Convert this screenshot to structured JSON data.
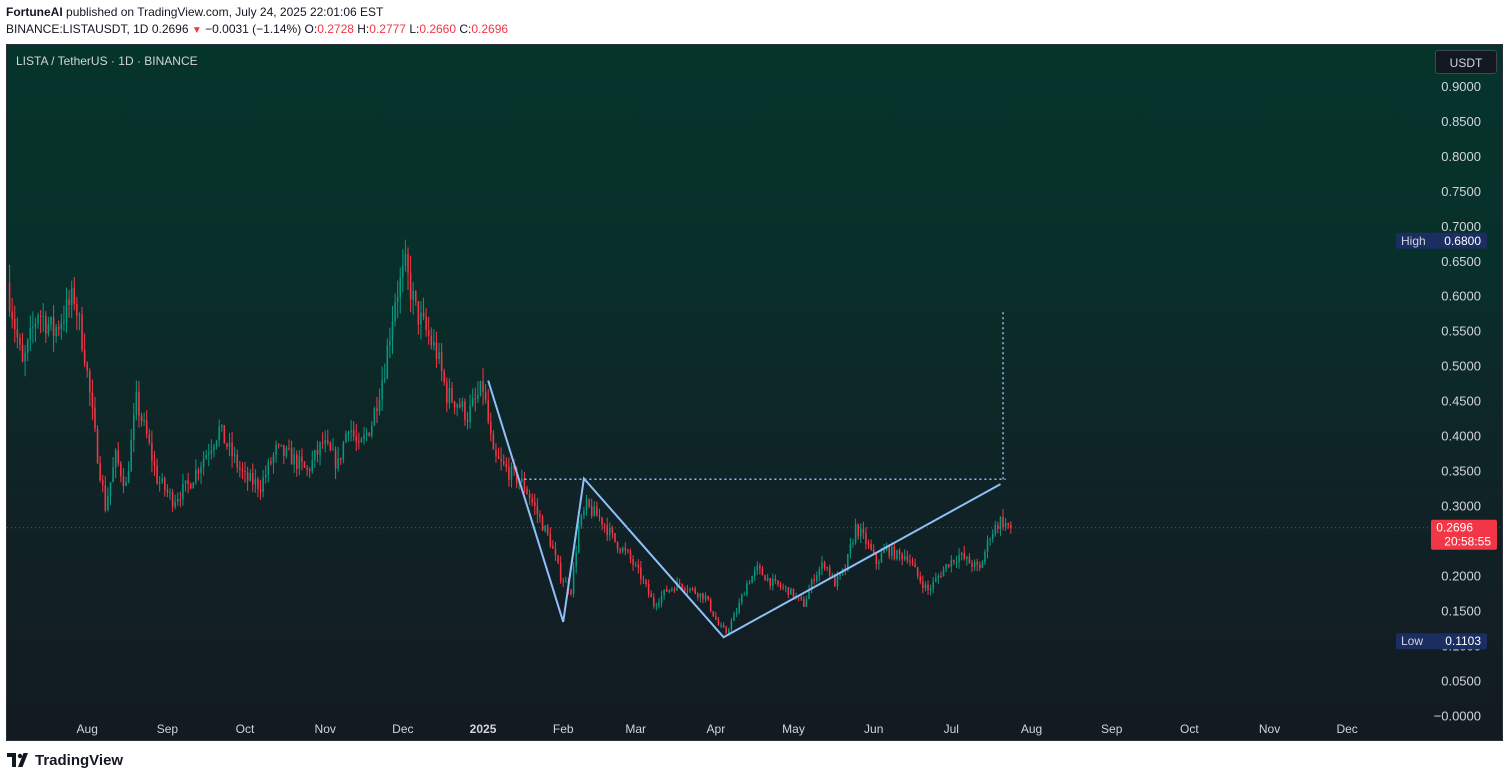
{
  "header": {
    "author": "FortuneAI",
    "published_text": "published on TradingView.com, July 24, 2025 22:01:06 EST",
    "symbol_line": "BINANCE:LISTAUSDT, 1D",
    "last": "0.2696",
    "change": "−0.0031 (−1.14%)",
    "o_label": "O:",
    "o": "0.2728",
    "h_label": "H:",
    "h": "0.2777",
    "l_label": "L:",
    "l": "0.2660",
    "c_label": "C:",
    "c": "0.2696"
  },
  "chart": {
    "symbol_title": "LISTA / TetherUS · 1D · BINANCE",
    "currency_button": "USDT",
    "high_label": "High",
    "high_value": "0.6800",
    "low_label": "Low",
    "low_value": "0.1103",
    "price_tag": "0.2696",
    "countdown": "20:58:55"
  },
  "footer": {
    "brand": "TradingView"
  },
  "colors": {
    "up": "#089981",
    "down": "#f23645",
    "drawing": "#90bff9",
    "axis_text": "#d1d4dc"
  },
  "chart_data": {
    "type": "candlestick",
    "y_ticks": [
      "0.9000",
      "0.8500",
      "0.8000",
      "0.7500",
      "0.7000",
      "0.6500",
      "0.6000",
      "0.5500",
      "0.5000",
      "0.4500",
      "0.4000",
      "0.3500",
      "0.3000",
      "0.2500",
      "0.2000",
      "0.1500",
      "0.1000",
      "0.0500",
      "−0.0000"
    ],
    "ylim": [
      -0.0125,
      0.96
    ],
    "x_labels": [
      {
        "label": "Aug",
        "day": 31,
        "bold": false
      },
      {
        "label": "Sep",
        "day": 62,
        "bold": false
      },
      {
        "label": "Oct",
        "day": 92,
        "bold": false
      },
      {
        "label": "Nov",
        "day": 123,
        "bold": false
      },
      {
        "label": "Dec",
        "day": 153,
        "bold": false
      },
      {
        "label": "2025",
        "day": 184,
        "bold": true
      },
      {
        "label": "Feb",
        "day": 215,
        "bold": false
      },
      {
        "label": "Mar",
        "day": 243,
        "bold": false
      },
      {
        "label": "Apr",
        "day": 274,
        "bold": false
      },
      {
        "label": "May",
        "day": 304,
        "bold": false
      },
      {
        "label": "Jun",
        "day": 335,
        "bold": false
      },
      {
        "label": "Jul",
        "day": 365,
        "bold": false
      },
      {
        "label": "Aug",
        "day": 396,
        "bold": false
      },
      {
        "label": "Sep",
        "day": 427,
        "bold": false
      },
      {
        "label": "Oct",
        "day": 457,
        "bold": false
      },
      {
        "label": "Nov",
        "day": 488,
        "bold": false
      },
      {
        "label": "Dec",
        "day": 518,
        "bold": false
      }
    ],
    "day_range": [
      0,
      545
    ],
    "last_day": 388,
    "price_anchors": [
      [
        0,
        0.62
      ],
      [
        6,
        0.5
      ],
      [
        12,
        0.58
      ],
      [
        18,
        0.55
      ],
      [
        26,
        0.6
      ],
      [
        30,
        0.52
      ],
      [
        34,
        0.4
      ],
      [
        38,
        0.3
      ],
      [
        42,
        0.37
      ],
      [
        46,
        0.33
      ],
      [
        50,
        0.45
      ],
      [
        54,
        0.4
      ],
      [
        58,
        0.34
      ],
      [
        64,
        0.31
      ],
      [
        70,
        0.33
      ],
      [
        76,
        0.37
      ],
      [
        82,
        0.41
      ],
      [
        86,
        0.38
      ],
      [
        92,
        0.34
      ],
      [
        98,
        0.33
      ],
      [
        104,
        0.38
      ],
      [
        110,
        0.37
      ],
      [
        116,
        0.35
      ],
      [
        122,
        0.39
      ],
      [
        128,
        0.36
      ],
      [
        132,
        0.42
      ],
      [
        136,
        0.38
      ],
      [
        141,
        0.42
      ],
      [
        146,
        0.5
      ],
      [
        150,
        0.6
      ],
      [
        154,
        0.64
      ],
      [
        158,
        0.58
      ],
      [
        162,
        0.55
      ],
      [
        166,
        0.52
      ],
      [
        170,
        0.46
      ],
      [
        174,
        0.45
      ],
      [
        178,
        0.43
      ],
      [
        184,
        0.47
      ],
      [
        188,
        0.37
      ],
      [
        194,
        0.35
      ],
      [
        200,
        0.33
      ],
      [
        205,
        0.29
      ],
      [
        210,
        0.25
      ],
      [
        214,
        0.2
      ],
      [
        218,
        0.18
      ],
      [
        221,
        0.27
      ],
      [
        224,
        0.3
      ],
      [
        227,
        0.29
      ],
      [
        230,
        0.28
      ],
      [
        235,
        0.25
      ],
      [
        240,
        0.23
      ],
      [
        245,
        0.2
      ],
      [
        250,
        0.16
      ],
      [
        255,
        0.18
      ],
      [
        260,
        0.19
      ],
      [
        265,
        0.18
      ],
      [
        270,
        0.17
      ],
      [
        275,
        0.13
      ],
      [
        278,
        0.12
      ],
      [
        282,
        0.15
      ],
      [
        286,
        0.19
      ],
      [
        290,
        0.21
      ],
      [
        296,
        0.19
      ],
      [
        302,
        0.18
      ],
      [
        308,
        0.16
      ],
      [
        312,
        0.2
      ],
      [
        316,
        0.22
      ],
      [
        320,
        0.19
      ],
      [
        324,
        0.21
      ],
      [
        328,
        0.27
      ],
      [
        332,
        0.25
      ],
      [
        336,
        0.22
      ],
      [
        340,
        0.24
      ],
      [
        344,
        0.23
      ],
      [
        348,
        0.23
      ],
      [
        352,
        0.2
      ],
      [
        356,
        0.18
      ],
      [
        360,
        0.2
      ],
      [
        364,
        0.22
      ],
      [
        368,
        0.23
      ],
      [
        372,
        0.22
      ],
      [
        376,
        0.21
      ],
      [
        380,
        0.26
      ],
      [
        384,
        0.28
      ],
      [
        388,
        0.2696
      ]
    ],
    "series": [
      {
        "kind": "zigzag_pattern",
        "points": [
          [
            186,
            0.48
          ],
          [
            215,
            0.135
          ],
          [
            223,
            0.34
          ],
          [
            277,
            0.113
          ],
          [
            384,
            0.332
          ]
        ]
      },
      {
        "kind": "horizontal_level",
        "y": 0.339,
        "x_from": 200,
        "x_to": 386
      },
      {
        "kind": "target_projection",
        "x": 385,
        "y_from": 0.339,
        "y_to": 0.58
      }
    ],
    "high": 0.68,
    "low": 0.1103,
    "last_price": 0.2696,
    "xlabel": "",
    "ylabel": "",
    "grid": false,
    "legend": "none"
  }
}
